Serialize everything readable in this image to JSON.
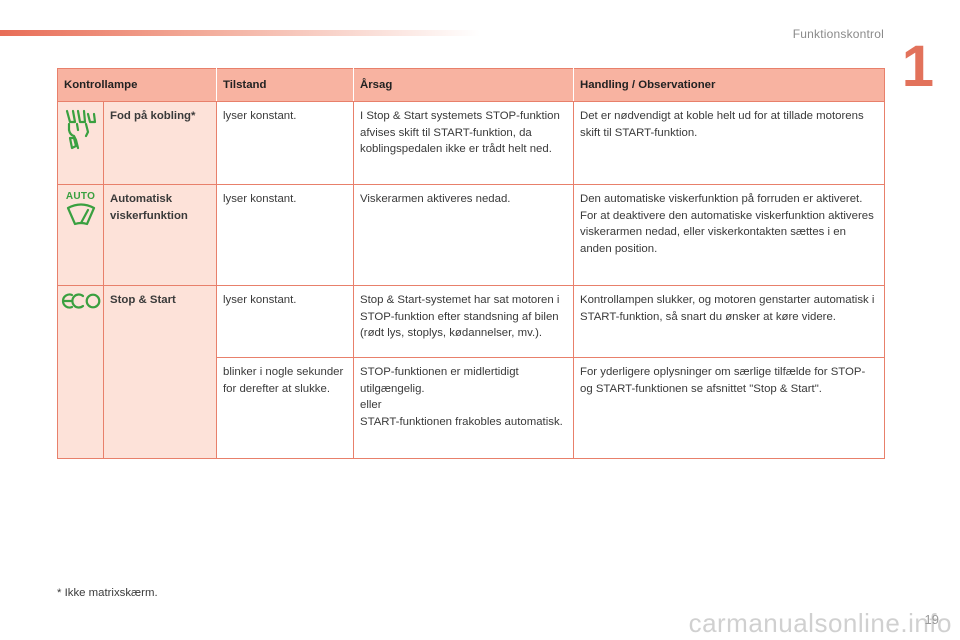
{
  "header": {
    "section_title": "Funktionskontrol",
    "chapter_number": "1"
  },
  "table": {
    "columns": [
      "Kontrollampe",
      "Tilstand",
      "Årsag",
      "Handling / Observationer"
    ],
    "rows": [
      {
        "icon": "clutch-foot-icon",
        "name": "Fod på kobling*",
        "state": "lyser konstant.",
        "cause": "I Stop & Start systemets STOP-funktion afvises skift til START-funktion, da koblingspedalen ikke er trådt helt ned.",
        "action": "Det er nødvendigt at koble helt ud for at tillade motorens skift til START-funktion."
      },
      {
        "icon": "auto-wiper-icon",
        "icon_text": "AUTO",
        "name": "Automatisk viskerfunktion",
        "state": "lyser konstant.",
        "cause": "Viskerarmen aktiveres nedad.",
        "action": "Den automatiske viskerfunktion på forruden er aktiveret.\nFor at deaktivere den automatiske viskerfunktion aktiveres viskerarmen nedad, eller viskerkontakten sættes i en anden position."
      },
      {
        "icon": "eco-icon",
        "icon_text": "ECO",
        "name": "Stop & Start",
        "state": "lyser konstant.",
        "cause": "Stop & Start-systemet har sat motoren i STOP-funktion efter standsning af bilen (rødt lys, stoplys, kødannelser, mv.).",
        "action": "Kontrollampen slukker, og motoren genstarter automatisk i START-funktion, så snart du ønsker at køre videre.",
        "sub_state": "blinker i nogle sekunder for derefter at slukke.",
        "sub_cause": "STOP-funktionen er midlertidigt utilgængelig.\neller\nSTART-funktionen frakobles automatisk.",
        "sub_action": "For yderligere oplysninger om særlige tilfælde for STOP- og START-funktionen se afsnittet \"Stop & Start\"."
      }
    ]
  },
  "footnote": "* Ikke matrixskærm.",
  "page_number": "19",
  "watermark": "carmanualsonline.info",
  "colors": {
    "accent": "#e2725b",
    "header_bg": "#f8b3a1",
    "name_bg": "#fde2d9",
    "indicator_green": "#3aa040"
  }
}
